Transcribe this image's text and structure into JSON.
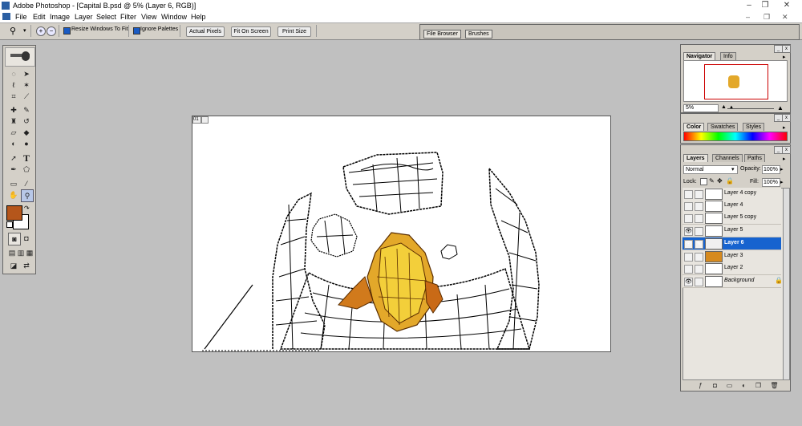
{
  "window": {
    "title": "Adobe Photoshop - [Capital B.psd @ 5% (Layer 6, RGB)]",
    "minimize": "–",
    "restore": "❐",
    "close": "✕"
  },
  "menu": [
    "File",
    "Edit",
    "Image",
    "Layer",
    "Select",
    "Filter",
    "View",
    "Window",
    "Help"
  ],
  "options": {
    "resize_windows_label": "Resize Windows To Fit",
    "ignore_palettes_label": "Ignore Palettes",
    "actual_pixels": "Actual Pixels",
    "fit_on_screen": "Fit On Screen",
    "print_size": "Print Size",
    "zoom_in_icon": "+",
    "zoom_out_icon": "−"
  },
  "palette_well": {
    "tabs": [
      "File Browser",
      "Brushes"
    ]
  },
  "navigator": {
    "tabs": [
      "Navigator",
      "Info"
    ],
    "zoom": "5%"
  },
  "color_palette": {
    "tabs": [
      "Color",
      "Swatches",
      "Styles"
    ]
  },
  "layers_palette": {
    "tabs": [
      "Layers",
      "Channels",
      "Paths"
    ],
    "blend_mode": "Normal",
    "opacity_label": "Opacity:",
    "opacity_value": "100%",
    "lock_label": "Lock:",
    "fill_label": "Fill:",
    "fill_value": "100%",
    "layers": [
      {
        "name": "Layer 4 copy",
        "visible": false,
        "selected": false
      },
      {
        "name": "Layer 4",
        "visible": false,
        "selected": false
      },
      {
        "name": "Layer 5 copy",
        "visible": false,
        "selected": false
      },
      {
        "name": "Layer 5",
        "visible": true,
        "selected": false
      },
      {
        "name": "Layer 6",
        "visible": true,
        "selected": true
      },
      {
        "name": "Layer 3",
        "visible": false,
        "selected": false
      },
      {
        "name": "Layer 2",
        "visible": false,
        "selected": false
      },
      {
        "name": "Background",
        "visible": true,
        "selected": false
      }
    ]
  },
  "colors": {
    "foreground": "#b5561b",
    "background": "#ffffff",
    "selection": "#1663cf"
  },
  "doc_tag": "01"
}
